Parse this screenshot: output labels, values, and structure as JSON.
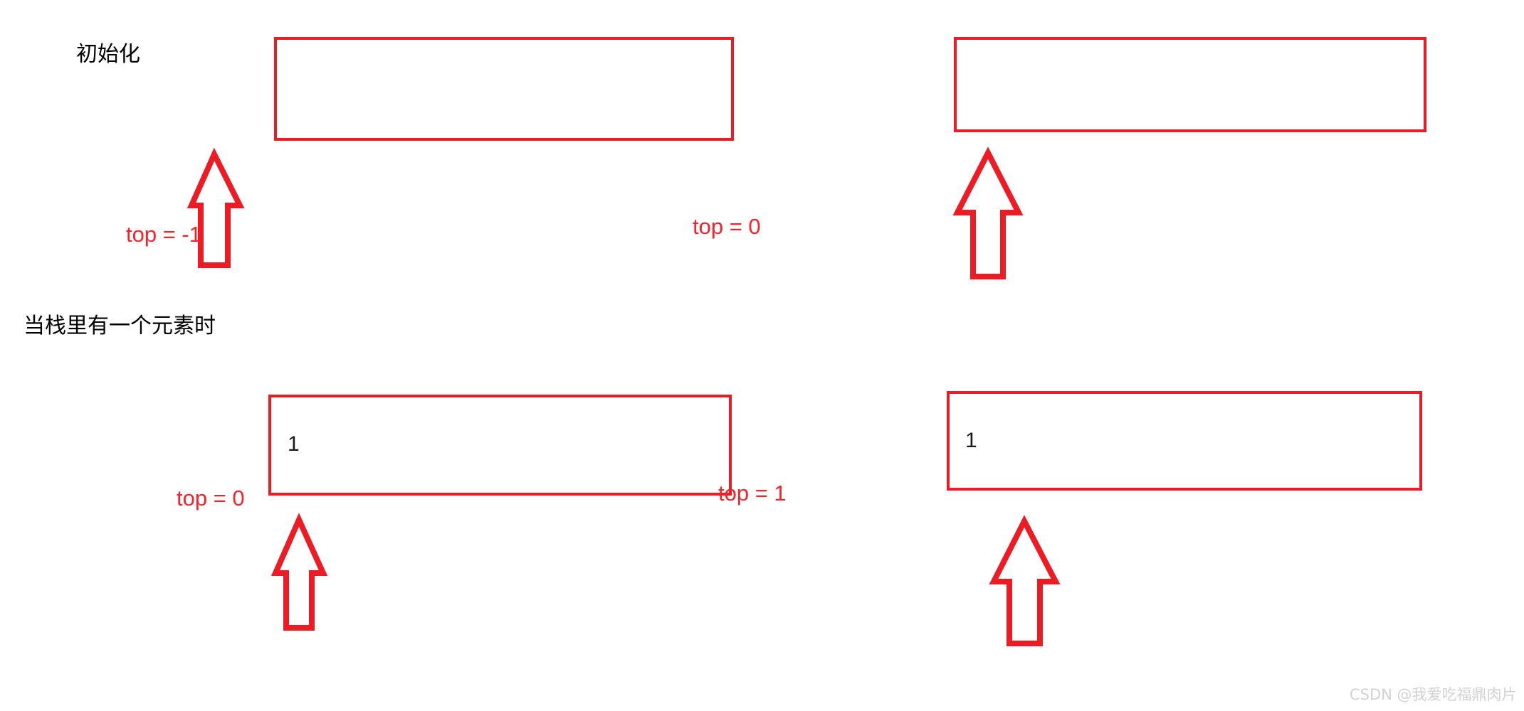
{
  "diagram": {
    "title": "stack-top-pointer-illustration",
    "accent_color": "#ED1C24",
    "label_color": "#F5232B",
    "text_color": "#000000",
    "background": "#ffffff"
  },
  "rows": [
    {
      "id": "initialization",
      "label": "初始化",
      "panels": [
        {
          "id": "init-empty",
          "cells": [],
          "top_label": "top = -1"
        },
        {
          "id": "init-after-push",
          "cells": [],
          "top_label": "top = 0"
        }
      ]
    },
    {
      "id": "one-element",
      "label": "当栈里有一个元素时",
      "panels": [
        {
          "id": "one-element-left",
          "cells": [
            "1"
          ],
          "top_label": "top = 0"
        },
        {
          "id": "one-element-right",
          "cells": [
            "1"
          ],
          "top_label": "top = 1"
        }
      ]
    }
  ],
  "cells": {
    "r2c1": "1",
    "r2c2": "1"
  },
  "labels": {
    "row1": "初始化",
    "row2": "当栈里有一个元素时",
    "top_r1_left": "top = -1",
    "top_r1_right": "top = 0",
    "top_r2_left": "top = 0",
    "top_r2_right": "top = 1"
  },
  "watermark": {
    "text": "CSDN @我爱吃福鼎肉片"
  },
  "icons": {
    "arrow_up": "arrow-up-outline-icon"
  }
}
